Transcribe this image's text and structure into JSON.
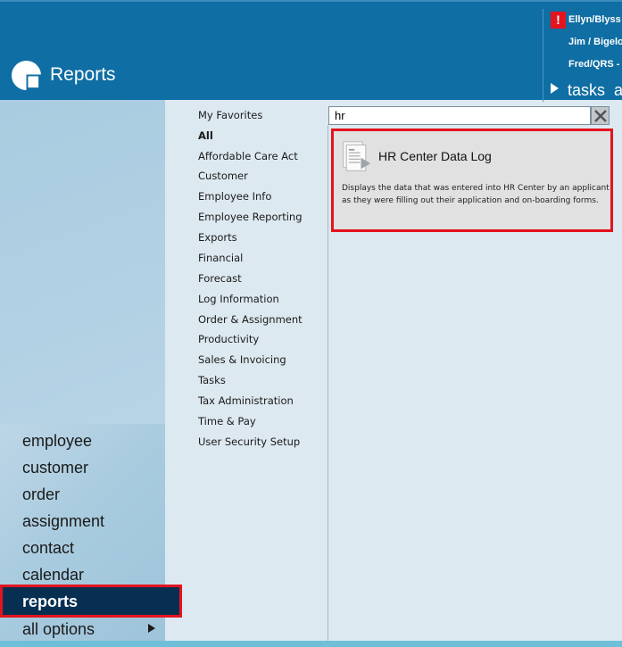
{
  "header": {
    "app_title": "Reports",
    "recent": [
      "Ellyn/Blyss C",
      "Jim / Bigelo",
      "Fred/QRS -"
    ],
    "tasks_label": "tasks",
    "tasks_trailing": "a",
    "alert_symbol": "!"
  },
  "nav": {
    "items": [
      "employee",
      "customer",
      "order",
      "assignment",
      "contact",
      "calendar"
    ],
    "active": "reports",
    "all_options": "all options"
  },
  "categories": [
    "My Favorites",
    "All",
    "Affordable Care Act",
    "Customer",
    "Employee Info",
    "Employee Reporting",
    "Exports",
    "Financial",
    "Forecast",
    "Log Information",
    "Order & Assignment",
    "Productivity",
    "Sales & Invoicing",
    "Tasks",
    "Tax Administration",
    "Time & Pay",
    "User Security Setup"
  ],
  "selected_category": "All",
  "search": {
    "value": "hr"
  },
  "result": {
    "title": "HR Center Data Log",
    "description": "Displays the data that was entered into HR Center by an applicant as they were filling out their application and on-boarding forms."
  },
  "colors": {
    "header": "#0f6ea3",
    "highlight": "#e3141e",
    "active_nav": "#062f52"
  },
  "icons": {
    "logo": "tempworks-logo-icon",
    "alert": "alert-icon",
    "clear": "close-icon",
    "report": "report-document-icon"
  }
}
